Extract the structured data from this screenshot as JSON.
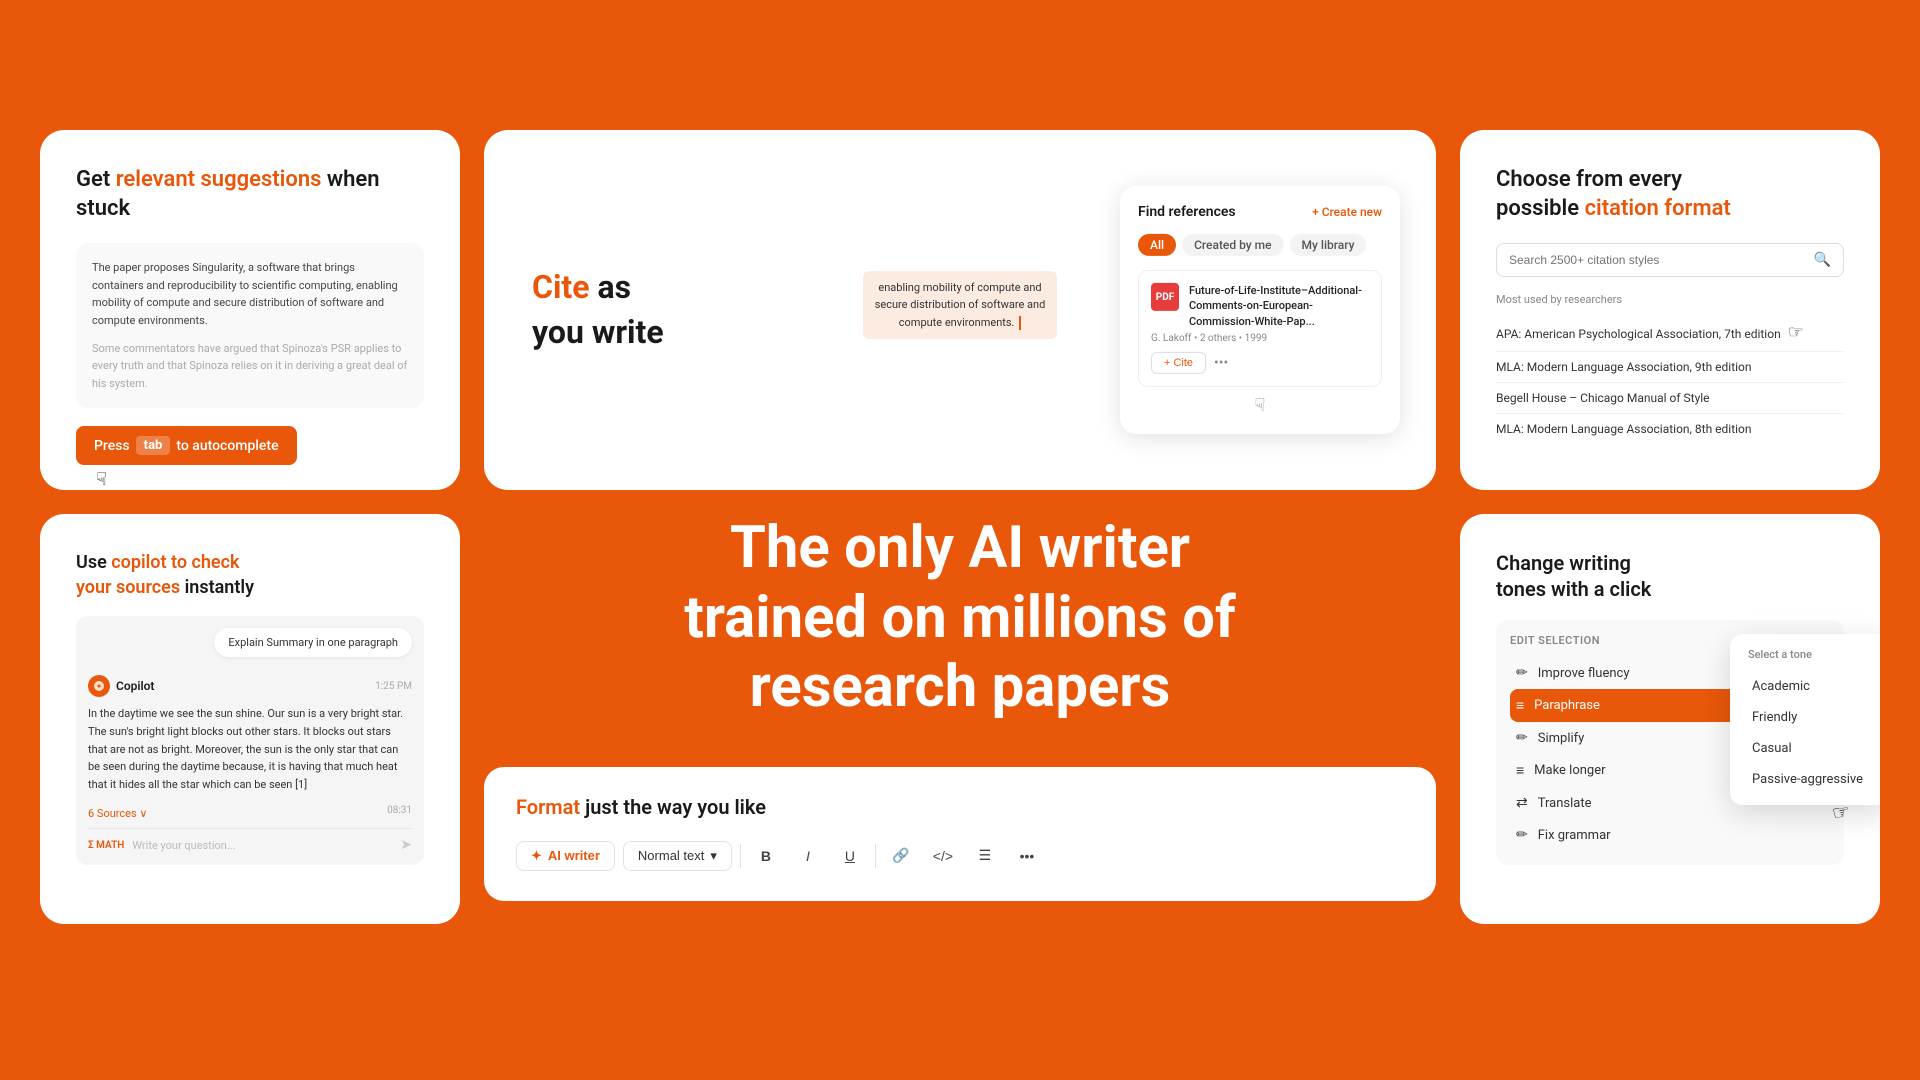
{
  "background_color": "#E8570A",
  "card1": {
    "title_plain": "Get ",
    "title_highlight": "relevant suggestions",
    "title_end": " when stuck",
    "doc_text": "The paper proposes Singularity, a software that brings containers and reproducibility to scientific computing, enabling mobility of compute and secure distribution of software and compute environments.",
    "doc_faded": "Some commentators have argued that Spinoza's PSR applies to every truth and that Spinoza relies on it in deriving a great deal of his system.",
    "autocomplete_prefix": "Press",
    "tab_label": "tab",
    "autocomplete_suffix": "to autocomplete"
  },
  "card2": {
    "cite_highlight": "Cite",
    "cite_rest": " as\nyou write",
    "panel_title": "Find references",
    "create_new": "+ Create new",
    "tabs": [
      "All",
      "Created by me",
      "My library"
    ],
    "active_tab": "All",
    "highlighted_text": "enabling mobility of compute and\nsecure distribution of software and\ncompute environments.",
    "ref_title": "Future-of-Life-Institute–Additional-Comments-on-European-Commission-White-Pap...",
    "ref_meta": "G. Lakoff • 2 others • 1999",
    "cite_btn": "+ Cite",
    "more_btn": "•••"
  },
  "card3": {
    "title_plain": "Choose from every\npossible ",
    "title_highlight": "citation format",
    "search_placeholder": "Search 2500+ citation styles",
    "most_used_label": "Most used by researchers",
    "citations": [
      "APA: American Psychological Association, 7th edition",
      "MLA: Modern Language Association, 9th edition",
      "Begell House – Chicago Manual of Style",
      "MLA: Modern Language Association, 8th edition"
    ]
  },
  "card4": {
    "title_plain": "Use ",
    "title_highlight": "copilot to check\nyour sources",
    "title_end": " instantly",
    "prompt": "Explain Summary in one paragraph",
    "copilot_name": "Copilot",
    "time": "1:25 PM",
    "response": "In the daytime we see the sun shine. Our sun is a very bright star. The sun's bright light blocks out other stars. It blocks out stars that are not as bright. Moreover, the sun is the only star that can be seen during the daytime because, it is having that much heat that it hides all the star which can be seen [1]",
    "sources": "6 Sources ∨",
    "timestamp": "08:31",
    "chat_placeholder": "Write your question...",
    "math_label": "Σ MATH"
  },
  "hero": {
    "line1": "The only AI writer",
    "line2": "trained on millions of",
    "line3": "research papers"
  },
  "format_card": {
    "title_plain": "",
    "title_highlight": "Format",
    "title_end": " just the way you like",
    "ai_writer_label": "AI writer",
    "normal_text_label": "Normal text",
    "toolbar_items": [
      "B",
      "I",
      "U",
      "🔗",
      "</>",
      "☰",
      "•••"
    ]
  },
  "card6": {
    "title_highlight": "Change writing\ntones",
    "title_plain": " with a click",
    "edit_section_title": "Edit selection",
    "items": [
      {
        "label": "Improve fluency",
        "icon": "✏️"
      },
      {
        "label": "Paraphrase",
        "icon": "≡",
        "active": true
      },
      {
        "label": "Simplify",
        "icon": "✏️"
      },
      {
        "label": "Make longer",
        "icon": "≡"
      },
      {
        "label": "Translate",
        "icon": "🌐"
      },
      {
        "label": "Fix grammar",
        "icon": "✏️"
      }
    ],
    "tone_dropdown_title": "Select a tone",
    "tones": [
      "Academic",
      "Friendly",
      "Casual",
      "Passive-aggressive"
    ]
  }
}
